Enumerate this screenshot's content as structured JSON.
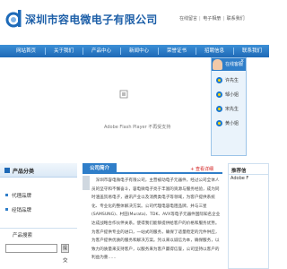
{
  "header": {
    "title": "深圳市容电微电子有限公司",
    "links": [
      "在线留言",
      "电子相册",
      "联系我们"
    ]
  },
  "nav": {
    "items": [
      "网站首页",
      "关于我们",
      "产品中心",
      "新闻中心",
      "荣誉证书",
      "招聘信息",
      "联系我们"
    ]
  },
  "banner": {
    "flash_message": "Adobe Flash Player 不再受支持"
  },
  "online_service": {
    "title": "在线客服",
    "agents": [
      "许先生",
      "邹小姐",
      "宋先生",
      "黄小姐"
    ],
    "close": "×"
  },
  "sidebar": {
    "title": "产品分类",
    "items": [
      "代理品牌",
      "经销品牌"
    ],
    "search_title": "产品搜索",
    "search_button": "提",
    "tail_text": "交"
  },
  "intro": {
    "title": "公司简介",
    "more": "+ 查看详细",
    "text": "深圳市容电微电子有限公司，主营被动电子元器件，经过公司全体人员的坚守和不懈奋斗，容电微电子亮于丰富的资源与服务经验，成为同时涵盖贸易电子，通讯产业以及消费类电子等领域，为客户提供系统化、专业化的整体解决方案。公司代理电容电阻品牌，并与三星(SAMSUNG)、村田(Murata)、TDK、AVX等电子元器件国际知名企业达成战略合作伙伴关系。使得我们能够提供给客户的价格和服务优势。为客户提供专业的进口，一站式的服务，确保了适量稳定的元件供应，为客户提供优质的服务和解决方案。凭以来以诚信为本，确保服务，以致力的质量来支持客户，以服务来为客户赢得信誉，公司坚持以客户的利益为重……"
  },
  "right": {
    "title": "推荐信",
    "link": "Adobe F"
  },
  "colors": {
    "brand": "#1d5fa8",
    "nav": "#2f7ec9",
    "accent_red": "#d21d1d"
  }
}
